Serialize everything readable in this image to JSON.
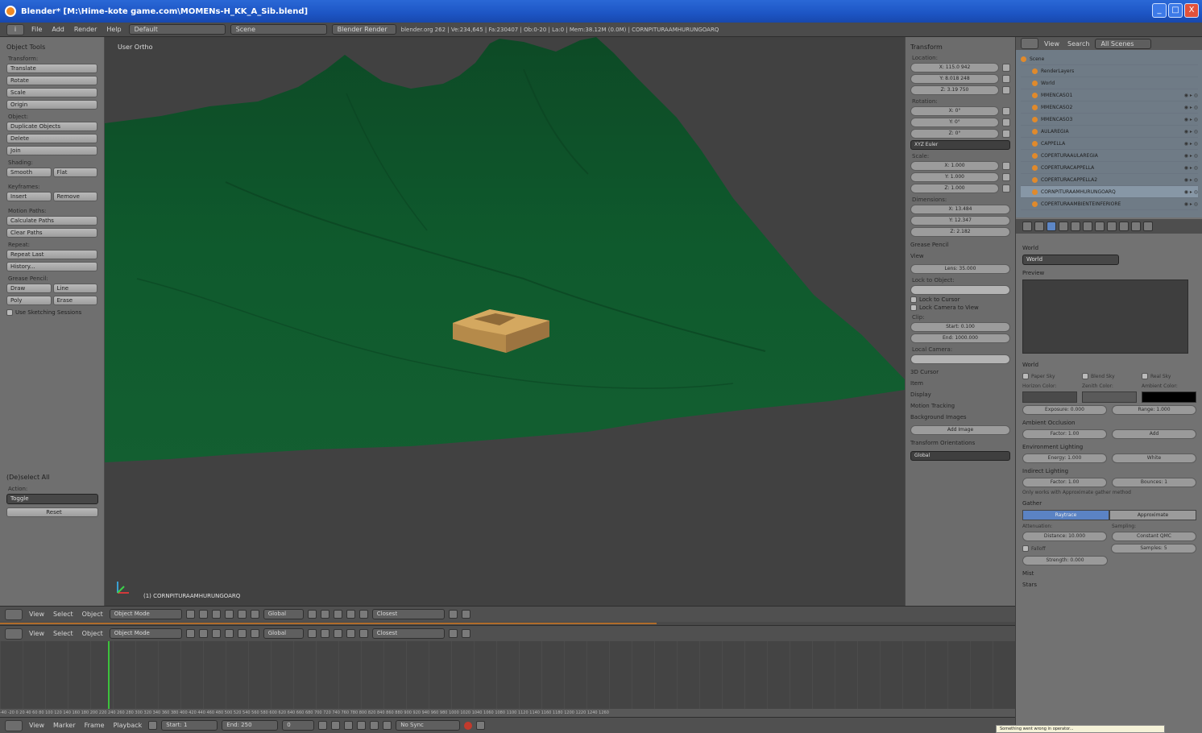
{
  "window": {
    "title": "Blender* [M:\\Hime-kote game.com\\MOMENs-H_KK_A_Sib.blend]",
    "controls": [
      "_",
      "□",
      "X"
    ]
  },
  "info_header": {
    "editor_icon": "i",
    "menus": [
      "File",
      "Add",
      "Render",
      "Help"
    ],
    "layout": "Default",
    "scene": "Scene",
    "engine": "Blender Render",
    "stats": "blender.org 262 | Ve:234,645 | Fa:230407 | Ob:0-20 | La:0 | Mem:38.12M (0.0M) | CORNPITURAAMHURUNGOARQ"
  },
  "tool_shelf": {
    "title": "Object Tools",
    "sections": [
      {
        "label": "Transform:",
        "buttons": [
          "Translate",
          "Rotate",
          "Scale",
          "Origin"
        ]
      },
      {
        "label": "Object:",
        "buttons": [
          "Duplicate Objects",
          "Delete",
          "Join"
        ]
      },
      {
        "label": "Shading:",
        "pair": [
          "Smooth",
          "Flat"
        ]
      },
      {
        "label": "Keyframes:",
        "pair": [
          "Insert",
          "Remove"
        ]
      },
      {
        "label": "Motion Paths:",
        "buttons": [
          "Calculate Paths",
          "Clear Paths"
        ]
      },
      {
        "label": "Repeat:",
        "buttons": [
          "Repeat Last",
          "History..."
        ]
      },
      {
        "label": "Grease Pencil:",
        "pairs": [
          [
            "Draw",
            "Line"
          ],
          [
            "Poly",
            "Erase"
          ]
        ]
      }
    ],
    "checkbox": "Use Sketching Sessions",
    "bottom_panel": "(De)select All",
    "action_label": "Action:",
    "action_value": "Toggle",
    "reset": "Reset"
  },
  "viewport": {
    "view_label": "User Ortho",
    "object_label": "(1) CORNPITURAAMHURUNGOARQ"
  },
  "n_panel": {
    "transform_head": "Transform",
    "location_label": "Location:",
    "location": [
      "X: 115.0 942",
      "Y: 8.018 248",
      "Z: 3.19 750"
    ],
    "rotation_label": "Rotation:",
    "rotation": [
      "X: 0°",
      "Y: 0°",
      "Z: 0°"
    ],
    "rotation_mode": "XYZ Euler",
    "scale_label": "Scale:",
    "scale": [
      "X: 1.000",
      "Y: 1.000",
      "Z: 1.000"
    ],
    "dimensions_label": "Dimensions:",
    "dimensions": [
      "X: 13.484",
      "Y: 12.347",
      "Z: 2.182"
    ],
    "grease": "Grease Pencil",
    "view": "View",
    "lens": "Lens: 35.000",
    "lock_label": "Lock to Object:",
    "lock_cursor": "Lock to Cursor",
    "lock_camera": "Lock Camera to View",
    "clip_label": "Clip:",
    "clip_start": "Start: 0.100",
    "clip_end": "End: 1000.000",
    "local_camera": "Local Camera:",
    "collapsed": [
      "3D Cursor",
      "Item",
      "Display",
      "Motion Tracking",
      "Background Images"
    ],
    "add_image": "Add Image",
    "transform_orientations": "Transform Orientations",
    "orientation": "Global"
  },
  "outliner": {
    "menus": [
      "View",
      "Search",
      "All Scenes"
    ],
    "rows": [
      {
        "name": "Scene",
        "indent": 0
      },
      {
        "name": "RenderLayers",
        "indent": 1
      },
      {
        "name": "World",
        "indent": 1
      },
      {
        "name": "MMENCASO1",
        "indent": 1
      },
      {
        "name": "MMENCASO2",
        "indent": 1
      },
      {
        "name": "MMENCASO3",
        "indent": 1
      },
      {
        "name": "AULAREGIA",
        "indent": 1
      },
      {
        "name": "CAPPELLA",
        "indent": 1
      },
      {
        "name": "COPERTURAAULAREGIA",
        "indent": 1
      },
      {
        "name": "COPERTURACAPPELLA",
        "indent": 1
      },
      {
        "name": "COPERTURACAPPELLA2",
        "indent": 1
      },
      {
        "name": "CORNPITURAAMHURUNGOARQ",
        "indent": 1
      },
      {
        "name": "COPERTURAAMBIENTEINFERIORE",
        "indent": 1
      }
    ]
  },
  "properties": {
    "context": "World",
    "world_name": "World",
    "preview": "Preview",
    "world_head": "World",
    "checks": [
      "Paper Sky",
      "Blend Sky",
      "Real Sky"
    ],
    "color_labels": [
      "Horizon Color:",
      "Zenith Color:",
      "Ambient Color:"
    ],
    "colors": [
      "#4a4a4a",
      "#5a5a5a",
      "#000000"
    ],
    "exposure": "Exposure: 0.000",
    "range": "Range: 1.000",
    "ambient_occlusion": "Ambient Occlusion",
    "ao_factor": "Factor: 1.00",
    "ao_mode": "Add",
    "env_lighting": "Environment Lighting",
    "env_energy": "Energy: 1.000",
    "env_color": "White",
    "indirect": "Indirect Lighting",
    "indirect_factor": "Factor: 1.00",
    "indirect_bounces": "Bounces: 1",
    "indirect_note": "Only works with Approximate gather method",
    "gather": "Gather",
    "gather_modes": [
      "Raytrace",
      "Approximate"
    ],
    "attenuation": "Attenuation:",
    "sampling": "Sampling:",
    "distance": "Distance: 10.000",
    "sampling_mode": "Constant QMC",
    "falloff": "Falloff",
    "samples": "Samples: 5",
    "strength": "Strength: 0.000",
    "mist": "Mist",
    "stars": "Stars"
  },
  "header3d": {
    "menus": [
      "View",
      "Select",
      "Object"
    ],
    "mode": "Object Mode",
    "orientation": "Global",
    "snap": "Closest"
  },
  "timeline": {
    "ruler": "-40  -20  0  20  40  60  80  100  120  140  160  180  200  220  240  260  280  300  320  340  360  380  400  420  440  460  480  500  520  540  560  580  600  620  640  660  680  700  720  740  760  780  800  820  840  860  880  900  920  940  960  980  1000  1020  1040  1060  1080  1100  1120  1140  1160  1180  1200  1220  1240  1260",
    "menus": [
      "View",
      "Marker",
      "Frame",
      "Playback"
    ],
    "start": "Start: 1",
    "end": "End: 250",
    "current": "0",
    "keying": "No Sync",
    "tooltip": "Something went wrong in operator..."
  }
}
